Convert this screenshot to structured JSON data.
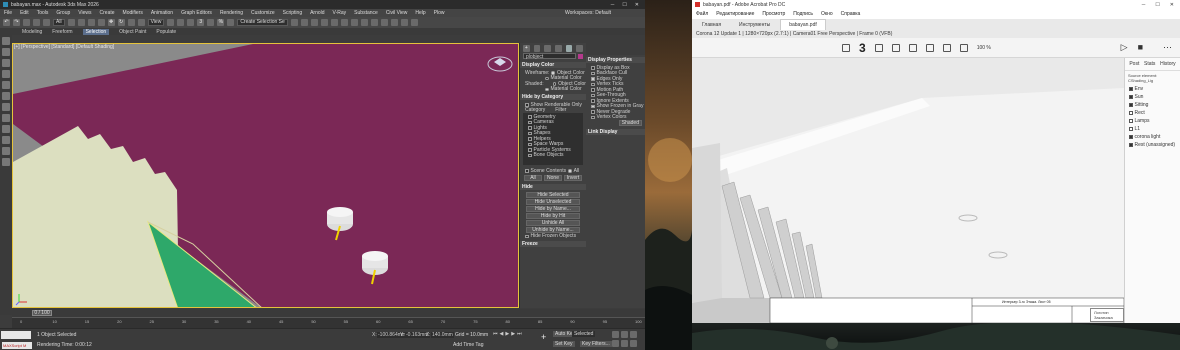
{
  "max": {
    "title": "babayan.max - Autodesk 3ds Max 2026",
    "workspace_label": "Workspaces: Default",
    "menu": [
      "File",
      "Edit",
      "Tools",
      "Group",
      "Views",
      "Create",
      "Modifiers",
      "Animation",
      "Graph Editors",
      "Rendering",
      "Customize",
      "Scripting",
      "Arnold",
      "V-Ray",
      "Substance",
      "Civil View",
      "Help",
      "Plow"
    ],
    "toolbar": {
      "filter": "All",
      "view": "View",
      "selection_set": "Create Selection Se"
    },
    "ribbon": [
      "Modeling",
      "Freeform",
      "Selection",
      "Object Paint",
      "Populate"
    ],
    "ribbon_active": "Selection",
    "viewport_label": "[+] [Perspective] [Standard] [Default Shading]",
    "command_panel": {
      "object_name": "plobject",
      "display_color_title": "Display Color",
      "wireframe_label": "Wireframe:",
      "wireframe_opts": [
        "Object Color",
        "Material Color"
      ],
      "shaded_label": "Shaded:",
      "shaded_opts": [
        "Object Color",
        "Material Color"
      ],
      "hide_by_category_title": "Hide by Category",
      "show_renderable_label": "Show Renderable Only",
      "category_label": "Category",
      "filter_label": "Filter",
      "categories": [
        "Geometry",
        "Cameras",
        "Lights",
        "Shapes",
        "Helpers",
        "Space Warps",
        "Particle Systems",
        "Bone Objects"
      ],
      "scene_contents_label": "Scene Contents",
      "all_label": "All",
      "btns_row": [
        "All",
        "None",
        "Invert"
      ],
      "hide_title": "Hide",
      "hide_buttons": [
        "Hide Selected",
        "Hide Unselected",
        "Hide by Name...",
        "Hide by Hit",
        "Unhide All",
        "Unhide by Name..."
      ],
      "hide_frozen_label": "Hide Frozen Objects",
      "freeze_title": "Freeze"
    },
    "display_properties": {
      "title": "Display Properties",
      "items": [
        {
          "label": "Display as Box",
          "on": false
        },
        {
          "label": "Backface Cull",
          "on": false
        },
        {
          "label": "Edges Only",
          "on": true
        },
        {
          "label": "Vertex Ticks",
          "on": false
        },
        {
          "label": "Motion Path",
          "on": false
        },
        {
          "label": "See-Through",
          "on": false
        },
        {
          "label": "Ignore Extents",
          "on": false
        },
        {
          "label": "Show Frozen in Gray",
          "on": true
        },
        {
          "label": "Never Degrade",
          "on": false
        },
        {
          "label": "Vertex Colors",
          "on": false
        }
      ],
      "shaded_btn": "Shaded",
      "link_display_title": "Link Display"
    },
    "timeline": {
      "frame": "0 / 100"
    },
    "track_ticks": [
      "0",
      "10",
      "15",
      "20",
      "25",
      "30",
      "35",
      "40",
      "45",
      "50",
      "55",
      "60",
      "65",
      "70",
      "75",
      "80",
      "85",
      "90",
      "95",
      "100"
    ],
    "status": {
      "selection": "1 Object Selected",
      "render_time": "Rendering Time: 0:00:12",
      "maxscript": "MAXScript M",
      "x_label": "X:",
      "y_label": "Y:",
      "z_label": "Z:",
      "x": "-100.864mm",
      "y": "-0.163mm",
      "z": "140.0mm",
      "grid": "Grid = 10.0mm",
      "add_time_tag": "Add Time Tag",
      "autokey": "Auto Key",
      "selected": "Selected",
      "set_key": "Set Key",
      "key_filters": "Key Filters..."
    }
  },
  "acrobat": {
    "title": "babayan.pdf - Adobe Acrobat Pro DC",
    "menu": [
      "Файл",
      "Редактирование",
      "Просмотр",
      "Подпись",
      "Окно",
      "Справка"
    ],
    "tabs": [
      "Главная",
      "Инструменты",
      "babayan.pdf"
    ],
    "active_tab": "babayan.pdf",
    "infobar": "Corona 12 Update 1 | 1280×720px (2.7:1) | Camera01 Free Perspective | Frame 0 (VFB)",
    "page_number": "3",
    "zoom": "100 %",
    "sidebar": {
      "tabs": [
        "Post",
        "Stats",
        "History"
      ],
      "header": "Source element: CShading_Lig",
      "layers": [
        {
          "label": "Env",
          "on": true
        },
        {
          "label": "Sun",
          "on": true
        },
        {
          "label": "Sitting",
          "on": true
        },
        {
          "label": "Rect",
          "on": false
        },
        {
          "label": "Lamps",
          "on": false
        },
        {
          "label": "L1",
          "on": false
        },
        {
          "label": "corona light",
          "on": true
        },
        {
          "label": "Rest (unassigned)",
          "on": true
        }
      ]
    },
    "title_block": {
      "stamp": "Логотип Заказчика",
      "doc_line": "Интерьер 3-го Этажа. Лист 05"
    }
  },
  "colors": {
    "magenta": "#7b2856",
    "cream": "#dcdfc0",
    "green": "#2ea86a",
    "frame": "#e5c33b"
  }
}
